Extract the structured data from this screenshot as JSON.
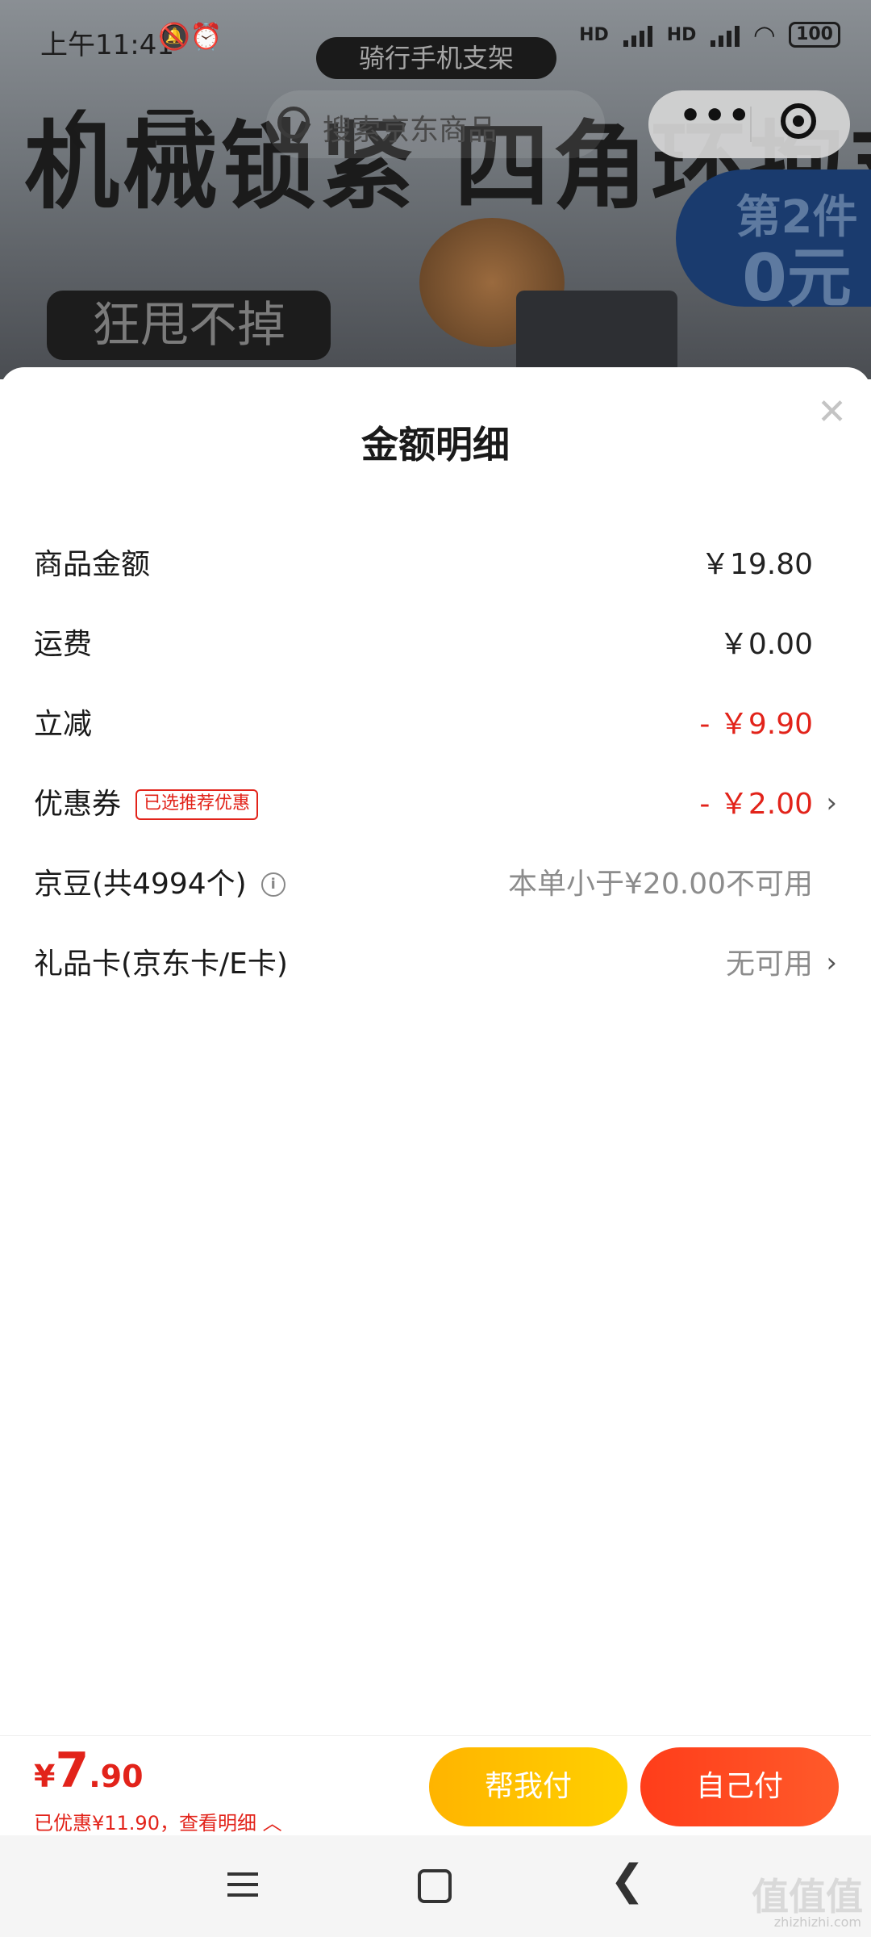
{
  "status_bar": {
    "time": "上午11:41",
    "battery": "100",
    "network_1": "HD",
    "network_2": "HD"
  },
  "background": {
    "category_tag": "骑行手机支架",
    "search_placeholder": "搜索京东商品",
    "banner_text": "机械锁紧 四角环抱支架",
    "slogan": "狂甩不掉",
    "promo_line1": "第2件",
    "promo_line2": "0元"
  },
  "sheet": {
    "title": "金额明细",
    "rows": [
      {
        "label": "商品金额",
        "value": "￥19.80"
      },
      {
        "label": "运费",
        "value": "￥0.00"
      },
      {
        "label": "立减",
        "value": "- ￥9.90"
      },
      {
        "label": "优惠券",
        "badge": "已选推荐优惠",
        "value": "- ￥2.00"
      },
      {
        "label": "京豆(共4994个)",
        "value": "本单小于¥20.00不可用"
      },
      {
        "label": "礼品卡(京东卡/E卡)",
        "value": "无可用"
      }
    ]
  },
  "pay_bar": {
    "currency": "¥",
    "amount_int": "7",
    "amount_dec": ".90",
    "saved_text": "已优惠¥11.90，查看明细 ︿",
    "help_pay": "帮我付",
    "self_pay": "自己付"
  },
  "watermark": {
    "main": "值值值",
    "sub": "zhizhizhi.com"
  },
  "colors": {
    "accent_red": "#e2231a",
    "help_button": "#ffc400",
    "self_button": "#ff4a22"
  }
}
